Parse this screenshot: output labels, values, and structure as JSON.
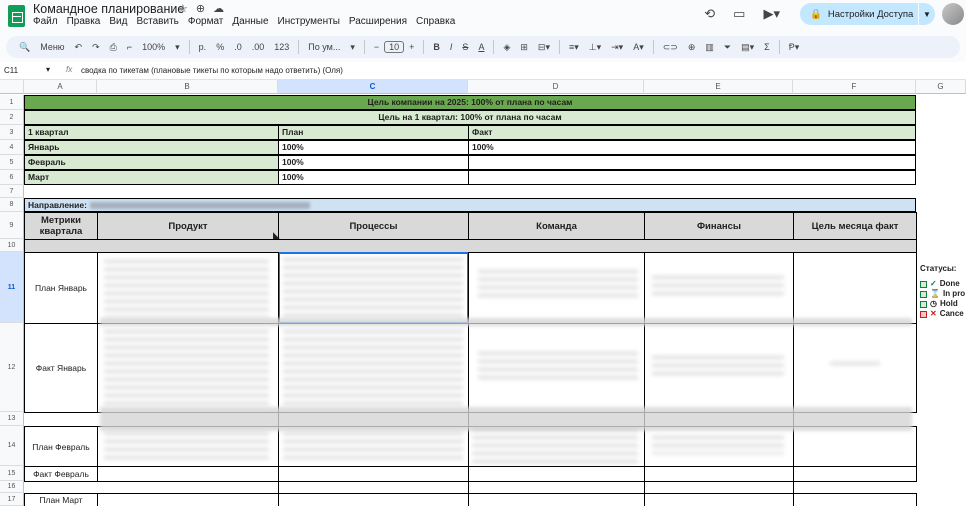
{
  "app": {
    "doc_title": "Командное планирование",
    "menu": [
      "Файл",
      "Правка",
      "Вид",
      "Вставить",
      "Формат",
      "Данные",
      "Инструменты",
      "Расширения",
      "Справка"
    ],
    "share_label": "Настройки Доступа",
    "icons": [
      "star-icon",
      "move-icon",
      "cloud-icon",
      "history-icon",
      "comment-icon",
      "video-icon",
      "lock-icon"
    ]
  },
  "toolbar": {
    "menu_search": "Меню",
    "zoom": "100%",
    "currency": "р.",
    "percent": "%",
    "dec_less": ".0",
    "dec_more": ".00",
    "number_format": "123",
    "font": "По ум...",
    "font_size": "10"
  },
  "formula_bar": {
    "cell_ref": "C11",
    "fx": "fx",
    "formula": "сводка по тикетам (плановые тикеты по которым надо ответить) (Оля)"
  },
  "columns": [
    "A",
    "B",
    "C",
    "D",
    "E",
    "F",
    "G"
  ],
  "rows": [
    "1",
    "2",
    "3",
    "4",
    "5",
    "6",
    "7",
    "8",
    "9",
    "10",
    "11",
    "12",
    "13",
    "14",
    "15",
    "16",
    "17"
  ],
  "sheet": {
    "goal_year": "Цель компании на 2025: 100% от плана по часам",
    "goal_q1": "Цель на 1 квартал: 100% от плана по часам",
    "q_header": "1 квартал",
    "plan_header": "План",
    "fact_header": "Факт",
    "months": [
      {
        "name": "Январь",
        "plan": "100%",
        "fact": "100%"
      },
      {
        "name": "Февраль",
        "plan": "100%",
        "fact": ""
      },
      {
        "name": "Март",
        "plan": "100%",
        "fact": ""
      }
    ],
    "direction_label": "Направление:",
    "table_headers": [
      "Метрики квартала",
      "Продукт",
      "Процессы",
      "Команда",
      "Финансы",
      "Цель месяца факт"
    ],
    "row_labels": [
      "План Январь",
      "Факт Январь",
      "План Февраль",
      "Факт Февраль",
      "План Март"
    ]
  },
  "statuses": {
    "title": "Статусы:",
    "items": [
      "Done",
      "In pro",
      "Hold",
      "Cance"
    ]
  }
}
